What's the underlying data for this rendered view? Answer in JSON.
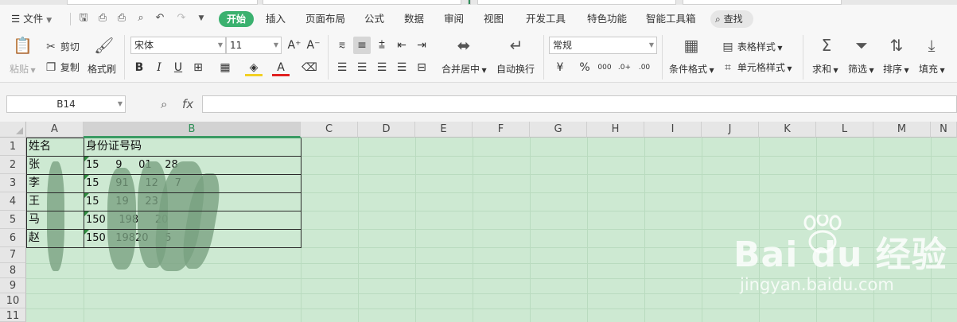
{
  "menubar": {
    "file_label": "文件",
    "tabs": [
      "开始",
      "插入",
      "页面布局",
      "公式",
      "数据",
      "审阅",
      "视图",
      "开发工具",
      "特色功能",
      "智能工具箱"
    ],
    "search_label": "查找"
  },
  "ribbon": {
    "paste": "粘贴",
    "cut": "剪切",
    "copy": "复制",
    "format_painter": "格式刷",
    "font_name": "宋体",
    "font_size": "11",
    "merge_center": "合并居中",
    "wrap_text": "自动换行",
    "number_format": "常规",
    "conditional_format": "条件格式",
    "table_style": "表格样式",
    "cell_style": "单元格样式",
    "sum": "求和",
    "filter": "筛选",
    "sort": "排序",
    "fill": "填充"
  },
  "formula_bar": {
    "cell_ref": "B14",
    "fx_label": "fx",
    "value": ""
  },
  "grid": {
    "columns": [
      "A",
      "B",
      "C",
      "D",
      "E",
      "F",
      "G",
      "H",
      "I",
      "J",
      "K",
      "L",
      "M",
      "N"
    ],
    "rows": [
      "1",
      "2",
      "3",
      "4",
      "5",
      "6",
      "7",
      "8",
      "9",
      "10",
      "11"
    ],
    "selected_column": "B",
    "header_a": "姓名",
    "header_b": "身份证号码",
    "names": [
      "张",
      "李",
      "王",
      "马",
      "赵"
    ],
    "ids": [
      "15     9     01    28",
      "15     91     12     7",
      "15     19     23",
      "150    198     20",
      "150   19820     5"
    ]
  },
  "watermark": {
    "logo": "Bai du 经验",
    "url": "jingyan.baidu.com"
  },
  "colors": {
    "accent": "#3bb16f",
    "sheet_bg": "#cde9d2",
    "selected_header": "#2e8f57"
  }
}
